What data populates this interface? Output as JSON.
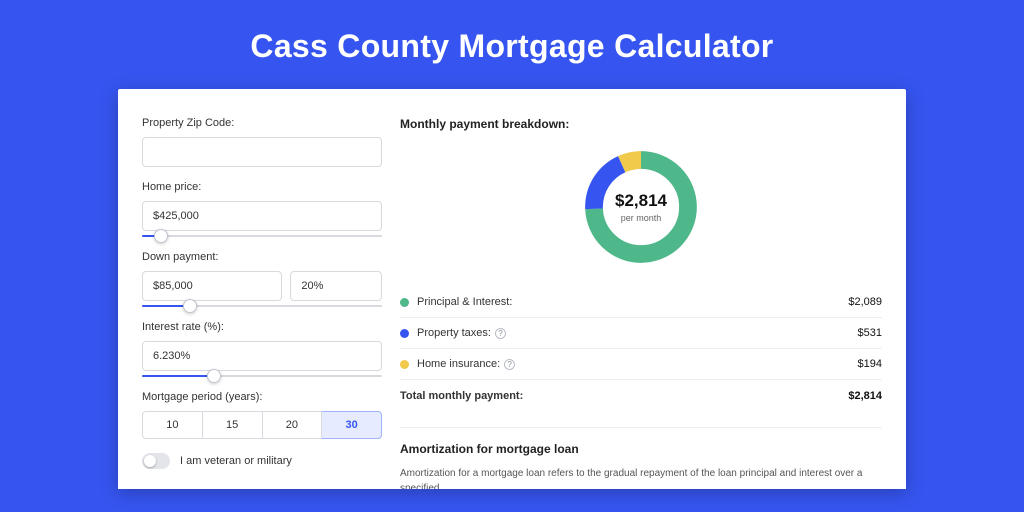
{
  "title": "Cass County Mortgage Calculator",
  "form": {
    "zip": {
      "label": "Property Zip Code:",
      "value": ""
    },
    "price": {
      "label": "Home price:",
      "value": "$425,000",
      "slider_pct": 8
    },
    "down": {
      "label": "Down payment:",
      "amount": "$85,000",
      "pct": "20%",
      "slider_pct": 20
    },
    "rate": {
      "label": "Interest rate (%):",
      "value": "6.230%",
      "slider_pct": 30
    },
    "period": {
      "label": "Mortgage period (years):",
      "options": [
        "10",
        "15",
        "20",
        "30"
      ],
      "active": "30"
    },
    "veteran_label": "I am veteran or military"
  },
  "breakdown": {
    "heading": "Monthly payment breakdown:",
    "center_value": "$2,814",
    "center_sub": "per month",
    "items": [
      {
        "label": "Principal & Interest:",
        "amount": "$2,089",
        "color": "green",
        "info": false
      },
      {
        "label": "Property taxes:",
        "amount": "$531",
        "color": "blue",
        "info": true
      },
      {
        "label": "Home insurance:",
        "amount": "$194",
        "color": "yellow",
        "info": true
      }
    ],
    "total_label": "Total monthly payment:",
    "total_amount": "$2,814"
  },
  "chart_data": {
    "type": "pie",
    "title": "Monthly payment breakdown",
    "series": [
      {
        "name": "Principal & Interest",
        "value": 2089,
        "color": "#4fb88a"
      },
      {
        "name": "Property taxes",
        "value": 531,
        "color": "#3655f0"
      },
      {
        "name": "Home insurance",
        "value": 194,
        "color": "#f1c94b"
      }
    ],
    "total": 2814,
    "unit": "USD/month"
  },
  "amort": {
    "title": "Amortization for mortgage loan",
    "text": "Amortization for a mortgage loan refers to the gradual repayment of the loan principal and interest over a specified"
  }
}
